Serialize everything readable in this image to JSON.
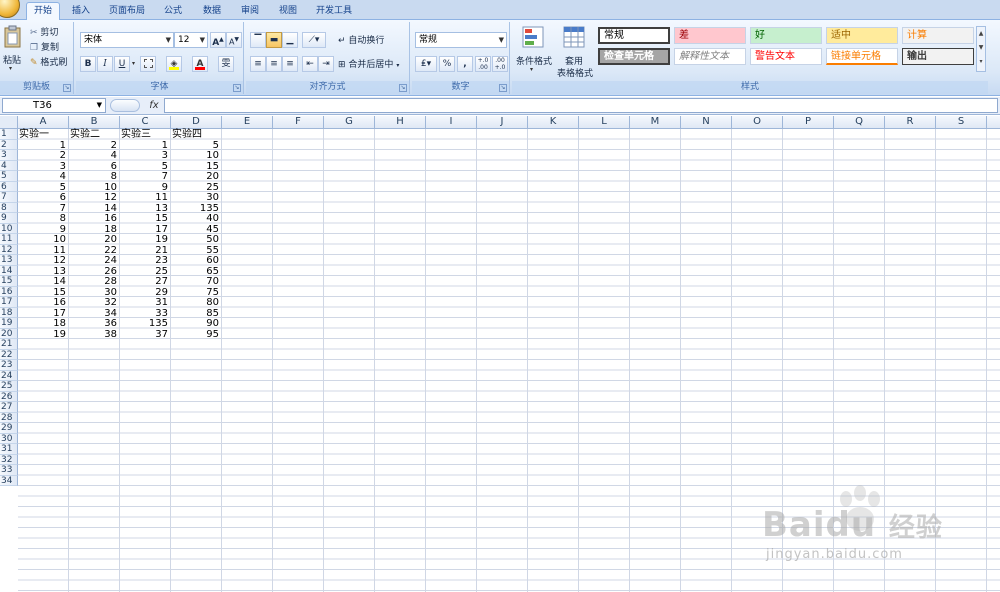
{
  "tabs": [
    "开始",
    "插入",
    "页面布局",
    "公式",
    "数据",
    "审阅",
    "视图",
    "开发工具"
  ],
  "active_tab": "开始",
  "clipboard": {
    "paste": "粘贴",
    "cut": "剪切",
    "copy": "复制",
    "format_painter": "格式刷",
    "label": "剪贴板"
  },
  "font": {
    "name": "宋体",
    "size": "12",
    "grow": "A",
    "shrink": "A",
    "bold": "B",
    "italic": "I",
    "underline": "U",
    "phonetic": "雯",
    "label": "字体"
  },
  "alignment": {
    "wrap_text": "自动换行",
    "merge_center": "合并后居中",
    "label": "对齐方式"
  },
  "number": {
    "format": "常规",
    "percent": "%",
    "comma": ",",
    "inc_decimal": "+.0 .00",
    "dec_decimal": ".00 +.0",
    "label": "数字"
  },
  "styles": {
    "conditional_format": "条件格式",
    "table_format_line1": "套用",
    "table_format_line2": "表格格式",
    "label": "样式",
    "cells": [
      {
        "text": "常规",
        "bg": "#ffffff",
        "color": "#000000"
      },
      {
        "text": "差",
        "bg": "#ffc7ce",
        "color": "#9c0006"
      },
      {
        "text": "好",
        "bg": "#c6efce",
        "color": "#006100"
      },
      {
        "text": "适中",
        "bg": "#ffeb9c",
        "color": "#9c6500"
      },
      {
        "text": "计算",
        "bg": "#f2f2f2",
        "color": "#fa7d00"
      },
      {
        "text": "检查单元格",
        "bg": "#a5a5a5",
        "color": "#ffffff"
      },
      {
        "text": "解释性文本",
        "bg": "#ffffff",
        "color": "#7f7f7f"
      },
      {
        "text": "警告文本",
        "bg": "#ffffff",
        "color": "#ff0000"
      },
      {
        "text": "链接单元格",
        "bg": "#ffffff",
        "color": "#fa7d00"
      },
      {
        "text": "输出",
        "bg": "#f2f2f2",
        "color": "#3f3f3f"
      }
    ]
  },
  "formula_bar": {
    "name_box": "T36",
    "fx": "fx",
    "formula": ""
  },
  "columns": [
    "A",
    "B",
    "C",
    "D",
    "E",
    "F",
    "G",
    "H",
    "I",
    "J",
    "K",
    "L",
    "M",
    "N",
    "O",
    "P",
    "Q",
    "R",
    "S"
  ],
  "rows": [
    "1",
    "2",
    "3",
    "4",
    "5",
    "6",
    "7",
    "8",
    "9",
    "10",
    "11",
    "12",
    "13",
    "14",
    "15",
    "16",
    "17",
    "18",
    "19",
    "20",
    "21",
    "22",
    "23",
    "24",
    "25",
    "26",
    "27",
    "28",
    "29",
    "30",
    "31",
    "32",
    "33",
    "34"
  ],
  "table": {
    "headers": [
      "实验一",
      "实验二",
      "实验三",
      "实验四"
    ],
    "data": [
      [
        1,
        2,
        1,
        5
      ],
      [
        2,
        4,
        3,
        10
      ],
      [
        3,
        6,
        5,
        15
      ],
      [
        4,
        8,
        7,
        20
      ],
      [
        5,
        10,
        9,
        25
      ],
      [
        6,
        12,
        11,
        30
      ],
      [
        7,
        14,
        13,
        135
      ],
      [
        8,
        16,
        15,
        40
      ],
      [
        9,
        18,
        17,
        45
      ],
      [
        10,
        20,
        19,
        50
      ],
      [
        11,
        22,
        21,
        55
      ],
      [
        12,
        24,
        23,
        60
      ],
      [
        13,
        26,
        25,
        65
      ],
      [
        14,
        28,
        27,
        70
      ],
      [
        15,
        30,
        29,
        75
      ],
      [
        16,
        32,
        31,
        80
      ],
      [
        17,
        34,
        33,
        85
      ],
      [
        18,
        36,
        135,
        90
      ],
      [
        19,
        38,
        37,
        95
      ]
    ]
  },
  "watermark": {
    "brand": "Bai",
    "brand2": "du",
    "cn": "经验",
    "url": "jingyan.baidu.com"
  }
}
